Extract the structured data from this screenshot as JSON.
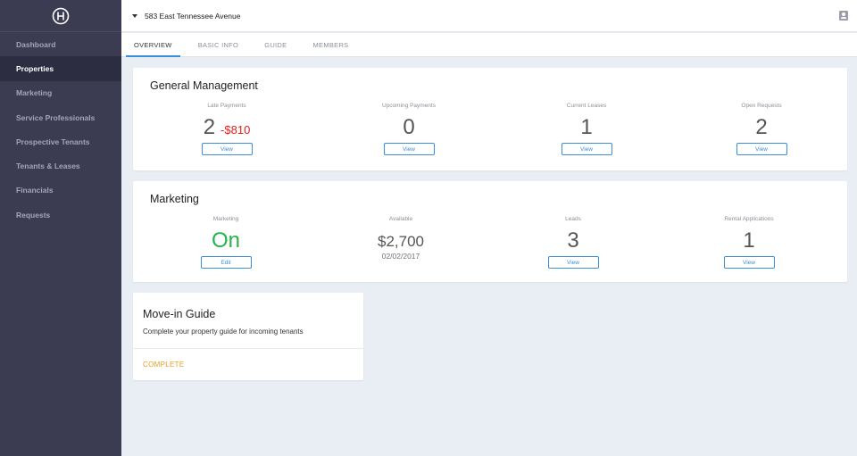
{
  "sidebar": {
    "logo": "H",
    "items": [
      {
        "label": "Dashboard"
      },
      {
        "label": "Properties"
      },
      {
        "label": "Marketing"
      },
      {
        "label": "Service Professionals"
      },
      {
        "label": "Prospective Tenants"
      },
      {
        "label": "Tenants & Leases"
      },
      {
        "label": "Financials"
      },
      {
        "label": "Requests"
      }
    ],
    "active": "Properties"
  },
  "header": {
    "address": "583 East Tennessee Avenue",
    "profile_icon": "account-box-icon"
  },
  "tabs": [
    {
      "label": "OVERVIEW",
      "active": true
    },
    {
      "label": "BASIC INFO",
      "active": false
    },
    {
      "label": "GUIDE",
      "active": false
    },
    {
      "label": "MEMBERS",
      "active": false
    }
  ],
  "general_management": {
    "title": "General Management",
    "stats": [
      {
        "label": "Late Payments",
        "value": "2",
        "extra": "-$810",
        "button": "View"
      },
      {
        "label": "Upcoming Payments",
        "value": "0",
        "button": "View"
      },
      {
        "label": "Current Leases",
        "value": "1",
        "button": "View"
      },
      {
        "label": "Open Requests",
        "value": "2",
        "button": "View"
      }
    ]
  },
  "marketing": {
    "title": "Marketing",
    "stats": [
      {
        "label": "Marketing",
        "value": "On",
        "button": "Edit"
      },
      {
        "label": "Available",
        "value": "$2,700",
        "sub": "02/02/2017"
      },
      {
        "label": "Leads",
        "value": "3",
        "button": "View"
      },
      {
        "label": "Rental Applications",
        "value": "1",
        "button": "View"
      }
    ]
  },
  "guide": {
    "title": "Move-in Guide",
    "description": "Complete your property guide for incoming tenants",
    "status": "COMPLETE"
  },
  "colors": {
    "sidebar_bg": "#3b3b52",
    "accent_blue": "#3b8ed8",
    "negative_red": "#e0201c",
    "positive_green": "#25b34b",
    "status_orange": "#f29a1c"
  }
}
